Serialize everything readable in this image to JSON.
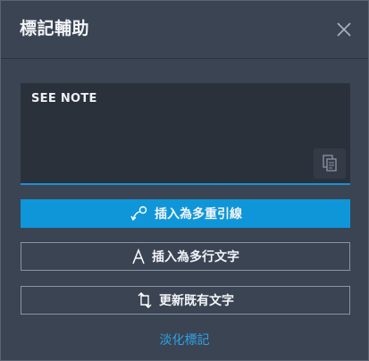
{
  "dialog": {
    "title": "標記輔助"
  },
  "note": {
    "text": "SEE NOTE"
  },
  "buttons": {
    "insert_multileader": "插入為多重引線",
    "insert_mtext": "插入為多行文字",
    "update_text": "更新既有文字",
    "fade_markup": "淡化標記"
  },
  "icons": {
    "close": "close-icon",
    "paste": "paste-icon",
    "multileader": "multileader-icon",
    "mtext": "mtext-icon",
    "update": "update-icon"
  },
  "colors": {
    "panel_bg": "#3b4453",
    "accent": "#0f96d9",
    "link": "#2ea3e8",
    "text_area_bg": "#2b313b"
  }
}
